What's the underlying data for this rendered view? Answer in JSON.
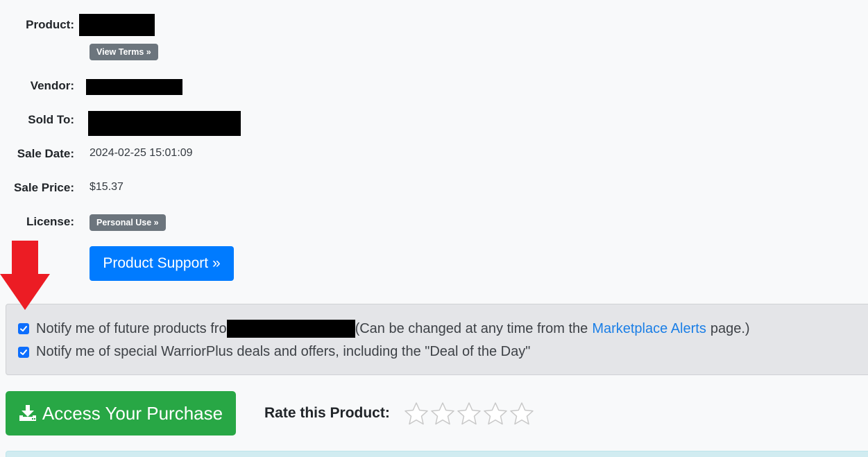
{
  "details": {
    "product_label": "Product:",
    "view_terms_label": "View Terms »",
    "vendor_label": "Vendor:",
    "sold_to_label": "Sold To:",
    "sale_date_label": "Sale Date:",
    "sale_date_value": "2024-02-25 15:01:09",
    "sale_price_label": "Sale Price:",
    "sale_price_value": "$15.37",
    "license_label": "License:",
    "license_badge": "Personal Use »"
  },
  "support_button_label": "Product Support »",
  "notifications": {
    "future_products_prefix": "Notify me of future products fro",
    "future_products_suffix": "(Can be changed at any time from the",
    "marketplace_alerts_link": "Marketplace Alerts",
    "future_products_end": "page.)",
    "deals_text": "Notify me of special WarriorPlus deals and offers, including the \"Deal of the Day\"",
    "future_products_checked": true,
    "deals_checked": true
  },
  "access_button_label": "Access Your Purchase",
  "rating": {
    "label": "Rate this Product:",
    "stars_total": 5,
    "stars_filled": 0
  },
  "icons": {
    "arrow": "red-down-arrow-icon",
    "download": "download-icon",
    "star": "star-outline-icon",
    "check": "check-icon"
  },
  "colors": {
    "primary": "#007bff",
    "success": "#28a745",
    "badge": "#6c757d",
    "link": "#1a7ee6",
    "arrow": "#ec1c24"
  }
}
